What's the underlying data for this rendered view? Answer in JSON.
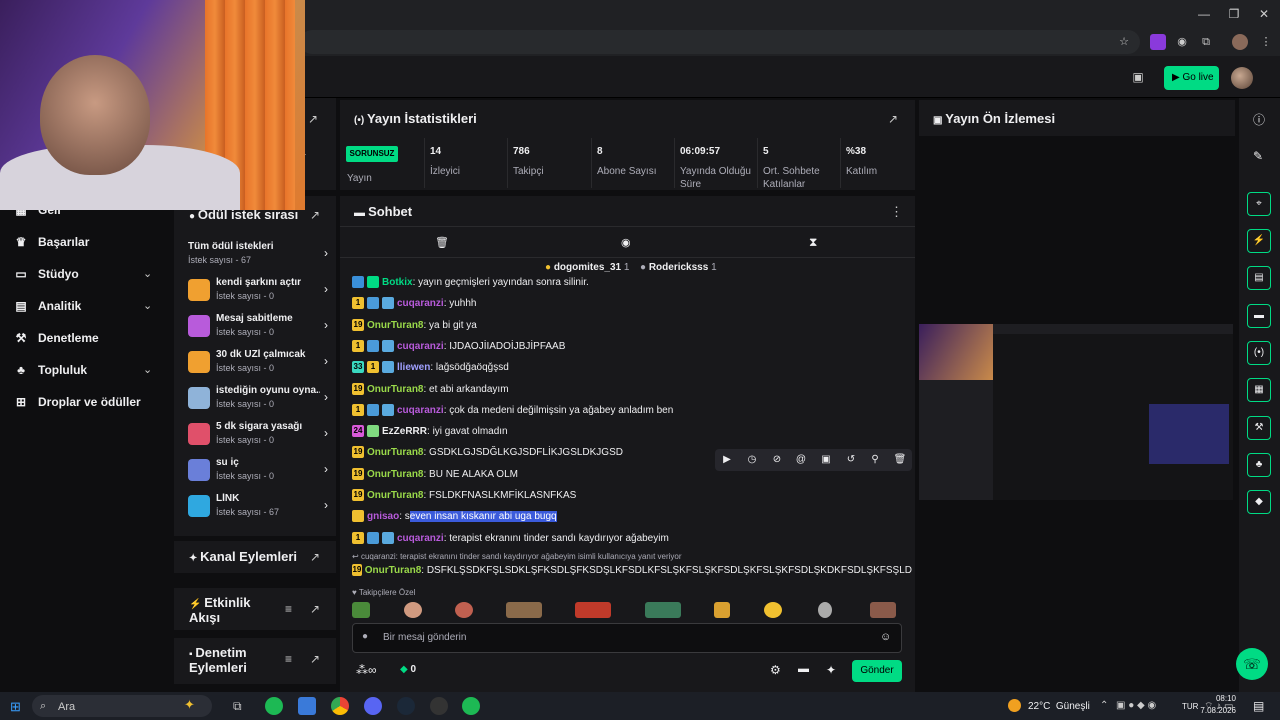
{
  "browser": {
    "minimize": "—",
    "maximize": "❐",
    "close": "✕"
  },
  "topnav": {
    "go_live": "Go live"
  },
  "sidebar": {
    "items": [
      {
        "label": "Geli",
        "icon": "chart-icon"
      },
      {
        "label": "Başarılar",
        "icon": "trophy-icon"
      },
      {
        "label": "Stüdyo",
        "icon": "studio-icon"
      },
      {
        "label": "Analitik",
        "icon": "analytics-icon"
      },
      {
        "label": "Denetleme",
        "icon": "moderation-icon"
      },
      {
        "label": "Topluluk",
        "icon": "community-icon"
      },
      {
        "label": "Droplar ve ödüller",
        "icon": "drops-icon"
      }
    ],
    "partial_text": "a"
  },
  "rewards": {
    "title": "Ödül istek sırası",
    "all_title": "Tüm ödül istekleri",
    "all_sub": "İstek sayısı - 67",
    "items": [
      {
        "title": "kendi şarkını açtır",
        "sub": "İstek sayısı - 0",
        "color": "#f0a030"
      },
      {
        "title": "Mesaj sabitleme",
        "sub": "İstek sayısı - 0",
        "color": "#b85bdb"
      },
      {
        "title": "30 dk UZİ çalmıcak",
        "sub": "İstek sayısı - 0",
        "color": "#f0a030"
      },
      {
        "title": "istediğin oyunu oyna...",
        "sub": "İstek sayısı - 0",
        "color": "#8fb3d9"
      },
      {
        "title": "5 dk sigara yasağı",
        "sub": "İstek sayısı - 0",
        "color": "#e0506a"
      },
      {
        "title": "su iç",
        "sub": "İstek sayısı - 0",
        "color": "#6a7fd9"
      },
      {
        "title": "LİNK",
        "sub": "İstek sayısı - 67",
        "color": "#2fa8e0"
      }
    ]
  },
  "channel_actions": {
    "title": "Kanal Eylemleri"
  },
  "activity_feed": {
    "title": "Etkinlik Akışı"
  },
  "mod_actions": {
    "title": "Denetim Eylemleri"
  },
  "stats": {
    "title": "Yayın İstatistikleri",
    "badge": "SORUNSUZ",
    "stream_label": "Yayın",
    "items": [
      {
        "value": "14",
        "label": "İzleyici"
      },
      {
        "value": "786",
        "label": "Takipçi"
      },
      {
        "value": "8",
        "label": "Abone Sayısı"
      },
      {
        "value": "06:09:57",
        "label": "Yayında Olduğu Süre"
      },
      {
        "value": "5",
        "label": "Ort. Sohbete Katılanlar"
      },
      {
        "value": "%38",
        "label": "Katılım"
      }
    ]
  },
  "preview": {
    "title": "Yayın Ön İzlemesi"
  },
  "chat": {
    "title": "Sohbet",
    "gifters": [
      {
        "name": "dogomites_31",
        "count": "1"
      },
      {
        "name": "Rodericksss",
        "count": "1"
      }
    ],
    "messages": [
      {
        "user": "Botkix",
        "user_color": "#00db84",
        "text": ": yayın geçmişleri yayından sonra silinir.",
        "badges": [
          "#3a8fd9",
          "#00db84"
        ],
        "badge_text": [
          "",
          ""
        ]
      },
      {
        "user": "cuqaranzi",
        "user_color": "#b85bdb",
        "text": ": yuhhh",
        "badges": [
          "#f0c030",
          "#4a9ad9",
          "#5aaadf"
        ],
        "badge_text": [
          "1",
          "",
          ""
        ]
      },
      {
        "user": "OnurTuran8",
        "user_color": "#9ad94a",
        "text": ": ya bi git ya",
        "badges": [
          "#f0c030"
        ],
        "badge_text": [
          "19"
        ]
      },
      {
        "user": "cuqaranzi",
        "user_color": "#b85bdb",
        "text": ": IJDAOJİIADOİJBJİPFAAB",
        "badges": [
          "#f0c030",
          "#4a9ad9",
          "#5aaadf"
        ],
        "badge_text": [
          "1",
          "",
          ""
        ]
      },
      {
        "user": "lliewen",
        "user_color": "#a0a0ff",
        "text": ": lağsödğaöqğşsd",
        "badges": [
          "#3ad9c0",
          "#f0c030",
          "#5aaadf"
        ],
        "badge_text": [
          "33",
          "1",
          ""
        ]
      },
      {
        "user": "OnurTuran8",
        "user_color": "#9ad94a",
        "text": ": et abi arkandayım",
        "badges": [
          "#f0c030"
        ],
        "badge_text": [
          "19"
        ]
      },
      {
        "user": "cuqaranzi",
        "user_color": "#b85bdb",
        "text": ": çok da medeni değilmişsin ya ağabey anladım ben",
        "badges": [
          "#f0c030",
          "#4a9ad9",
          "#5aaadf"
        ],
        "badge_text": [
          "1",
          "",
          ""
        ]
      },
      {
        "user": "EzZeRRR",
        "user_color": "#efeff1",
        "text": ": iyi gavat olmadın",
        "badges": [
          "#d95ad9",
          "#7fd97f"
        ],
        "badge_text": [
          "24",
          ""
        ]
      },
      {
        "user": "OnurTuran8",
        "user_color": "#9ad94a",
        "text": ": GSDKLGJSDĞLKGJSDFLİKJGSLDKJGSD",
        "badges": [
          "#f0c030"
        ],
        "badge_text": [
          "19"
        ]
      },
      {
        "user": "OnurTuran8",
        "user_color": "#9ad94a",
        "text": ": BU NE ALAKA OLM",
        "badges": [
          "#f0c030"
        ],
        "badge_text": [
          "19"
        ]
      },
      {
        "user": "OnurTuran8",
        "user_color": "#9ad94a",
        "text": ": FSLDKFNASLKMFİKLASNFKAS",
        "badges": [
          "#f0c030"
        ],
        "badge_text": [
          "19"
        ]
      },
      {
        "user": "gnisao",
        "user_color": "#b85bdb",
        "text_pre": ": s",
        "text_hl": "even insan kıskanır abi uga bugq",
        "badges": [
          "#f0c030"
        ],
        "badge_text": [
          ""
        ]
      },
      {
        "user": "cuqaranzi",
        "user_color": "#b85bdb",
        "text": ": terapist ekranını tinder sandı kaydırıyor ağabeyim",
        "badges": [
          "#f0c030",
          "#4a9ad9",
          "#5aaadf"
        ],
        "badge_text": [
          "1",
          "",
          ""
        ]
      }
    ],
    "reply_note": "cuqaranzi: terapist ekranını tinder sandı kaydırıyor ağabeyim isimli kullanıcıya yanıt veriyor",
    "last_message": {
      "user": "OnurTuran8",
      "user_color": "#9ad94a",
      "text": ": DSFKLŞSDKFŞLSDKLŞFKSDLŞFKSDŞLKFSDLKFSLŞKFSLŞKFSDLŞKFSLŞKFSDLŞKDKFSDLŞKFSŞLD",
      "badge_text": "19"
    },
    "followers_only": "Takipçilere Özel",
    "input_placeholder": "Bir mesaj gönderin",
    "points": "∞",
    "bits": "0",
    "send": "Gönder"
  },
  "taskbar": {
    "search": "Ara",
    "weather": "22°C  Güneşli",
    "lang": "TUR",
    "time": "08:10",
    "date": "7.08.2026"
  }
}
